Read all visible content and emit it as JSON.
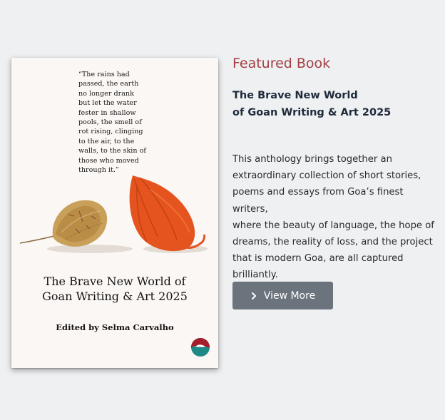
{
  "book_cover": {
    "quote": "“The rains had\npassed, the earth\nno longer drank\nbut let the water\nfester in shallow\npools, the smell of\nrot rising, clinging\nto the air, to the\nwalls, to the skin of\nthose who moved\nthrough it.”",
    "title": "The Brave New World of\nGoan Writing & Art 2025",
    "editor": "Edited by Selma Carvalho",
    "logo_icon": "publisher-bird-logo"
  },
  "featured": {
    "heading": "Featured Book",
    "title": "The Brave New World\nof Goan Writing & Art 2025",
    "description": "This anthology brings together an\nextraordinary collection of short stories,\npoems and essays from Goa’s finest writers,\nwhere the beauty of language, the hope of\ndreams, the reality of loss, and the project\nthat is modern Goa, are all captured\nbrilliantly.",
    "button_label": "View More",
    "button_icon": "chevron-right-icon"
  },
  "colors": {
    "background": "#eef0f2",
    "heading_accent": "#a43e43",
    "button_bg": "#6b737d",
    "title_text": "#1f2a3a"
  }
}
